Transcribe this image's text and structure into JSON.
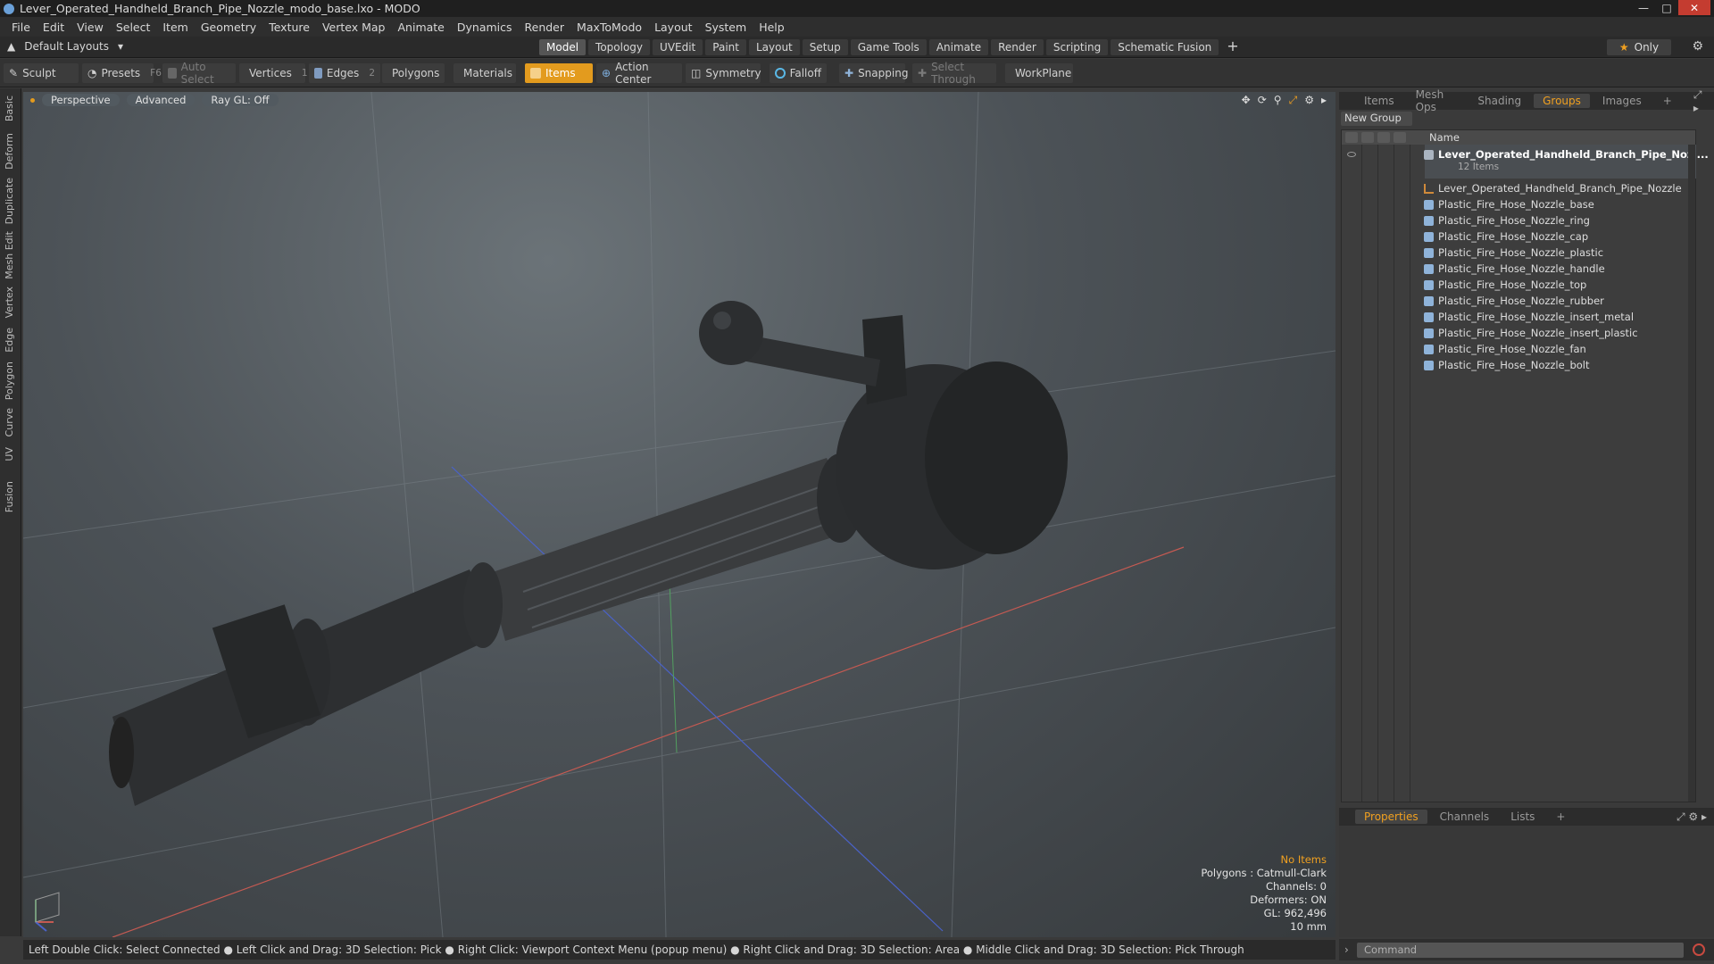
{
  "window": {
    "title": "Lever_Operated_Handheld_Branch_Pipe_Nozzle_modo_base.lxo - MODO"
  },
  "menu": [
    "File",
    "Edit",
    "View",
    "Select",
    "Item",
    "Geometry",
    "Texture",
    "Vertex Map",
    "Animate",
    "Dynamics",
    "Render",
    "MaxToModo",
    "Layout",
    "System",
    "Help"
  ],
  "layout_bar": {
    "default_layouts": "Default Layouts",
    "tabs": [
      "Model",
      "Topology",
      "UVEdit",
      "Paint",
      "Layout",
      "Setup",
      "Game Tools",
      "Animate",
      "Render",
      "Scripting",
      "Schematic Fusion"
    ],
    "active_tab": "Model",
    "only_label": "Only"
  },
  "toolbar": {
    "sculpt": "Sculpt",
    "presets": "Presets",
    "presets_key": "F6",
    "auto_select": "Auto Select",
    "vertices": "Vertices",
    "vertices_count": "1",
    "edges": "Edges",
    "edges_count": "2",
    "polygons": "Polygons",
    "materials": "Materials",
    "items": "Items",
    "action_center": "Action Center",
    "symmetry": "Symmetry",
    "falloff": "Falloff",
    "snapping": "Snapping",
    "select_through": "Select Through",
    "workplane": "WorkPlane"
  },
  "left_tabs": [
    "Basic",
    "Deform",
    "Duplicate",
    "Mesh Edit",
    "Vertex",
    "Edge",
    "Polygon",
    "Curve",
    "UV",
    "Fusion"
  ],
  "viewport": {
    "view": "Perspective",
    "shading": "Advanced",
    "raygl": "Ray GL: Off",
    "stats": {
      "selection": "No Items",
      "polygons": "Polygons : Catmull-Clark",
      "channels": "Channels: 0",
      "deformers": "Deformers: ON",
      "gl": "GL: 962,496",
      "scale": "10 mm"
    }
  },
  "status": "Left Double Click: Select Connected ● Left Click and Drag: 3D Selection: Pick ● Right Click: Viewport Context Menu (popup menu) ● Right Click and Drag: 3D Selection: Area ● Middle Click and Drag: 3D Selection: Pick Through",
  "items_panel": {
    "tabs": [
      "Items",
      "Mesh Ops",
      "Shading",
      "Groups",
      "Images"
    ],
    "active_tab": "Groups",
    "new_group": "New Group",
    "column_name": "Name",
    "group_name": "Lever_Operated_Handheld_Branch_Pipe_Noz ...",
    "group_count": "12 Items",
    "rows": [
      "Lever_Operated_Handheld_Branch_Pipe_Nozzle",
      "Plastic_Fire_Hose_Nozzle_base",
      "Plastic_Fire_Hose_Nozzle_ring",
      "Plastic_Fire_Hose_Nozzle_cap",
      "Plastic_Fire_Hose_Nozzle_plastic",
      "Plastic_Fire_Hose_Nozzle_handle",
      "Plastic_Fire_Hose_Nozzle_top",
      "Plastic_Fire_Hose_Nozzle_rubber",
      "Plastic_Fire_Hose_Nozzle_insert_metal",
      "Plastic_Fire_Hose_Nozzle_insert_plastic",
      "Plastic_Fire_Hose_Nozzle_fan",
      "Plastic_Fire_Hose_Nozzle_bolt"
    ]
  },
  "properties_panel": {
    "tabs": [
      "Properties",
      "Channels",
      "Lists"
    ],
    "active_tab": "Properties"
  },
  "command": {
    "placeholder": "Command"
  }
}
